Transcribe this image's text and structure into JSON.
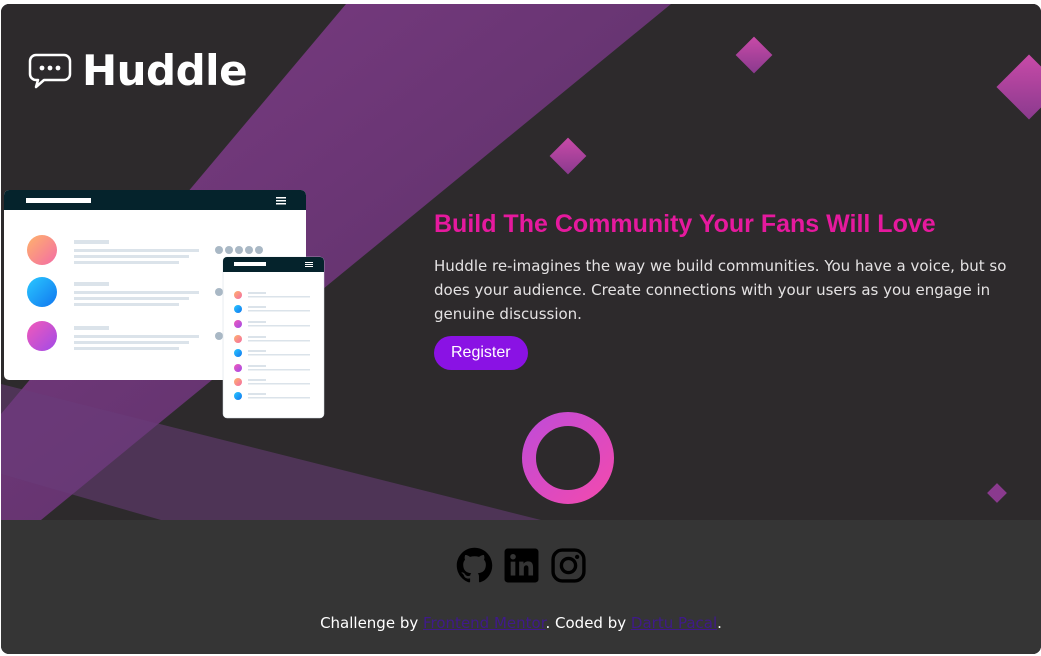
{
  "brand": {
    "name": "Huddle",
    "logo_icon": "chat-bubble-icon"
  },
  "hero": {
    "headline": "Build The Community Your Fans Will Love",
    "description": "Huddle re-imagines the way we build communities. You have a voice, but so does your audience. Create connections with your users as you engage in genuine discussion.",
    "cta_label": "Register"
  },
  "footer": {
    "social": [
      {
        "name": "github-icon"
      },
      {
        "name": "linkedin-icon"
      },
      {
        "name": "instagram-icon"
      }
    ],
    "credit_prefix": "Challenge by ",
    "credit_link_1": "Frontend Mentor",
    "credit_middle": ". Coded by ",
    "credit_link_2": "Dartu Pacal",
    "credit_suffix": "."
  },
  "colors": {
    "background": "#2d2a2c",
    "footer": "#353535",
    "headline": "#e6199e",
    "button": "#8a12e4",
    "link": "#3f1a8a"
  }
}
